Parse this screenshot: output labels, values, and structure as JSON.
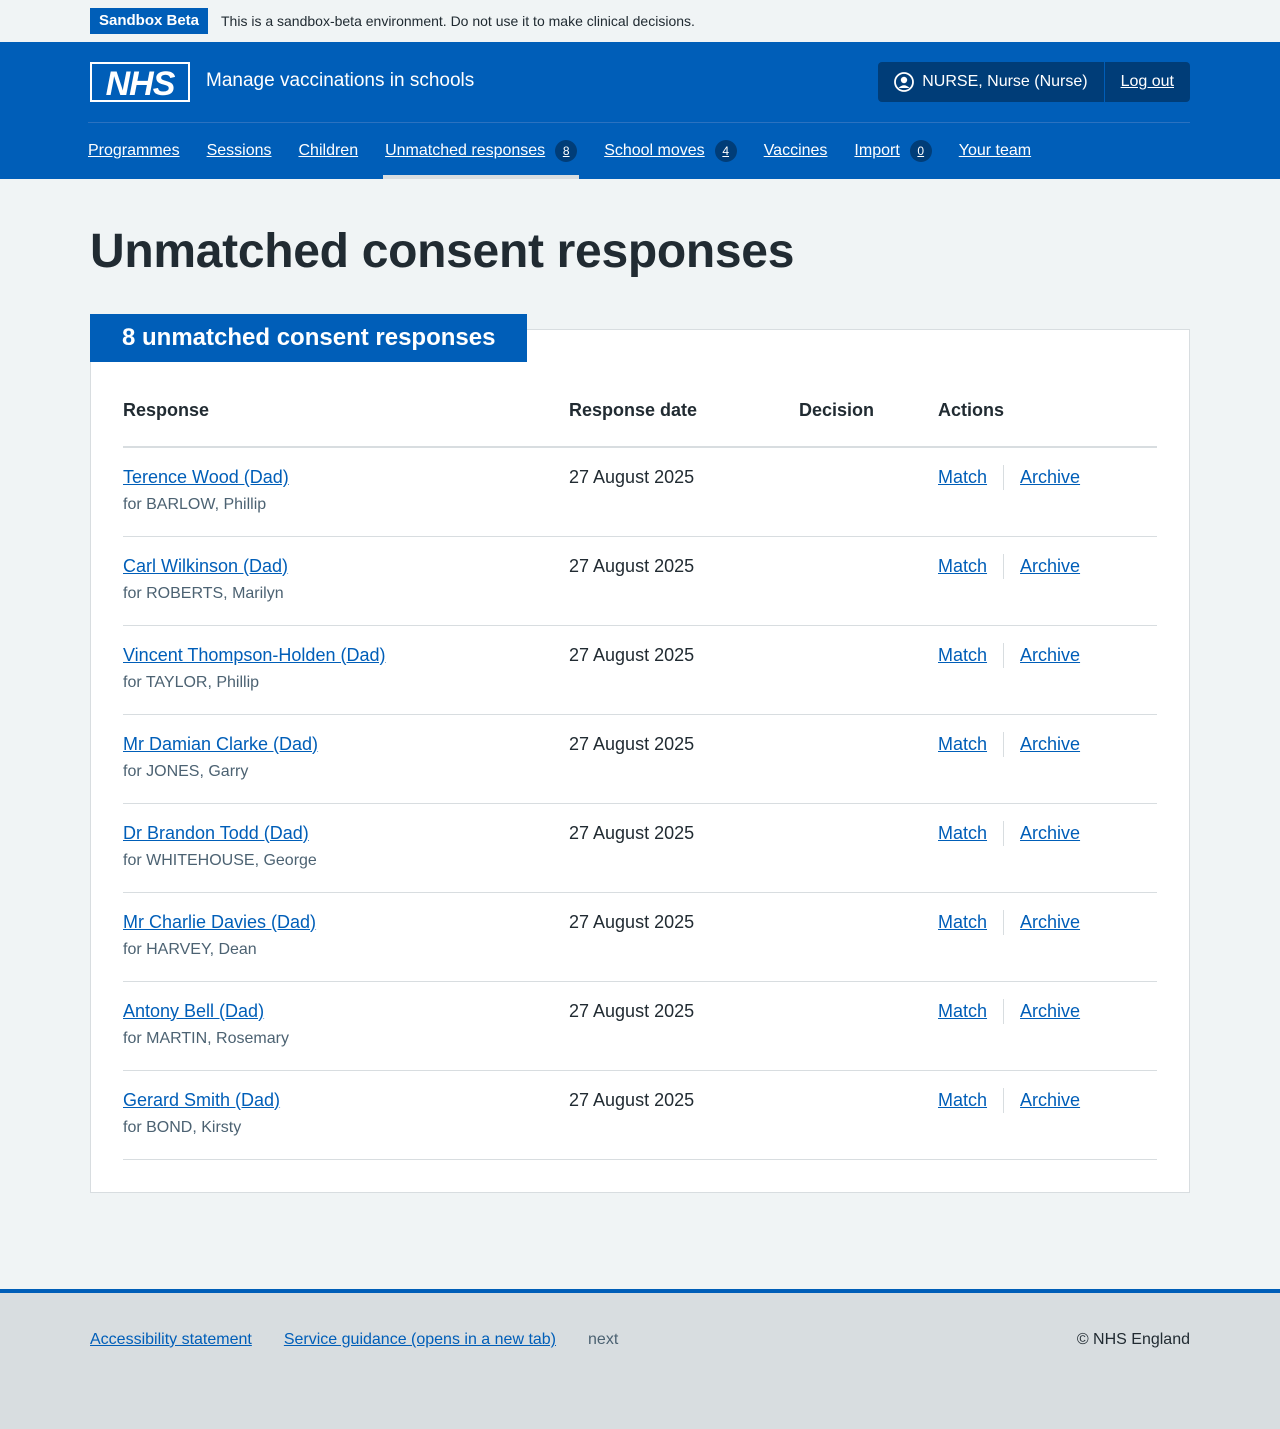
{
  "banner": {
    "tag": "Sandbox Beta",
    "text": "This is a sandbox-beta environment. Do not use it to make clinical decisions."
  },
  "header": {
    "logo_text": "NHS",
    "service_name": "Manage vaccinations in schools",
    "account_user": "NURSE, Nurse (Nurse)",
    "logout": "Log out"
  },
  "nav": {
    "items": [
      {
        "label": "Programmes"
      },
      {
        "label": "Sessions"
      },
      {
        "label": "Children"
      },
      {
        "label": "Unmatched responses",
        "count": "8",
        "active": true
      },
      {
        "label": "School moves",
        "count": "4"
      },
      {
        "label": "Vaccines"
      },
      {
        "label": "Import",
        "count": "0"
      },
      {
        "label": "Your team"
      }
    ]
  },
  "main": {
    "title": "Unmatched consent responses",
    "card_heading": "8 unmatched consent responses",
    "columns": {
      "response": "Response",
      "date": "Response date",
      "decision": "Decision",
      "actions": "Actions"
    },
    "action_labels": {
      "match": "Match",
      "archive": "Archive"
    },
    "rows": [
      {
        "name": "Terence Wood (Dad)",
        "for": "for BARLOW, Phillip",
        "date": "27 August 2025",
        "decision": ""
      },
      {
        "name": "Carl Wilkinson (Dad)",
        "for": "for ROBERTS, Marilyn",
        "date": "27 August 2025",
        "decision": ""
      },
      {
        "name": "Vincent Thompson-Holden (Dad)",
        "for": "for TAYLOR, Phillip",
        "date": "27 August 2025",
        "decision": ""
      },
      {
        "name": "Mr Damian Clarke (Dad)",
        "for": "for JONES, Garry",
        "date": "27 August 2025",
        "decision": ""
      },
      {
        "name": "Dr Brandon Todd (Dad)",
        "for": "for WHITEHOUSE, George",
        "date": "27 August 2025",
        "decision": ""
      },
      {
        "name": "Mr Charlie Davies (Dad)",
        "for": "for HARVEY, Dean",
        "date": "27 August 2025",
        "decision": ""
      },
      {
        "name": "Antony Bell (Dad)",
        "for": "for MARTIN, Rosemary",
        "date": "27 August 2025",
        "decision": ""
      },
      {
        "name": "Gerard Smith (Dad)",
        "for": "for BOND, Kirsty",
        "date": "27 August 2025",
        "decision": ""
      }
    ]
  },
  "footer": {
    "accessibility": "Accessibility statement",
    "guidance": "Service guidance (opens in a new tab)",
    "next": "next",
    "copyright": "© NHS England"
  },
  "colors": {
    "nhs_blue": "#005eb8",
    "dark_blue": "#003d78",
    "page_bg": "#f0f4f5",
    "text": "#212b32",
    "secondary_text": "#4c6272",
    "border": "#d8dde0"
  }
}
